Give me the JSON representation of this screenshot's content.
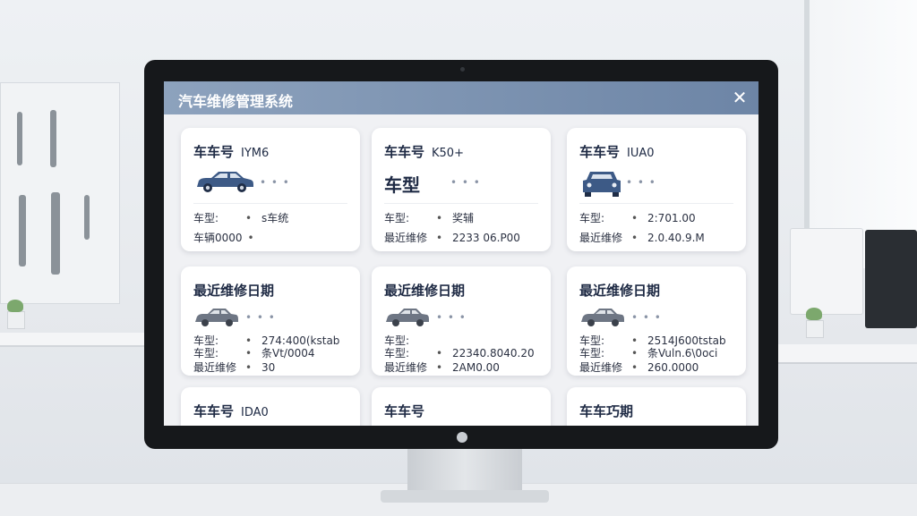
{
  "app": {
    "title": "汽车维修管理系统",
    "close_label": "✕"
  },
  "cards": [
    {
      "title": "车车号",
      "plate": "IYM6",
      "big_label": "",
      "vehicle": "car-side-icon",
      "rows": [
        {
          "label": "车型:",
          "value": "s车统"
        },
        {
          "label": "车辆0000",
          "value": ""
        }
      ]
    },
    {
      "title": "车车号",
      "plate": "K50+",
      "big_label": "车型",
      "vehicle": "",
      "rows": [
        {
          "label": "车型:",
          "value": "奖辅"
        },
        {
          "label": "最近维修",
          "value": "2233 06.P00"
        }
      ]
    },
    {
      "title": "车车号",
      "plate": "IUA0",
      "big_label": "",
      "vehicle": "car-front-icon",
      "rows": [
        {
          "label": "车型:",
          "value": "2:701.00"
        },
        {
          "label": "最近维修",
          "value": "2.0.40.9.M"
        }
      ]
    },
    {
      "title": "最近维修日期",
      "plate": "",
      "big_label": "",
      "vehicle": "car-side-icon",
      "rows": [
        {
          "label": "车型:",
          "value": "274:400(kstab"
        },
        {
          "label": "车型:",
          "value": "条Vt/0004"
        },
        {
          "label": "最近维修",
          "value": "30"
        }
      ]
    },
    {
      "title": "最近维修日期",
      "plate": "",
      "big_label": "",
      "vehicle": "car-side-icon",
      "rows": [
        {
          "label": "车型:",
          "value": ""
        },
        {
          "label": "车型:",
          "value": "22340.8040.20"
        },
        {
          "label": "最近维修",
          "value": "2AM0.00"
        }
      ]
    },
    {
      "title": "最近维修日期",
      "plate": "",
      "big_label": "",
      "vehicle": "car-side-icon",
      "rows": [
        {
          "label": "车型:",
          "value": "2514J600tstab"
        },
        {
          "label": "车型:",
          "value": "条Vuln.6\\0oci"
        },
        {
          "label": "最近维修",
          "value": "260.0000"
        }
      ]
    },
    {
      "title": "车车号",
      "plate": "IDA0",
      "big_label": "",
      "vehicle": "",
      "rows": []
    },
    {
      "title": "车车号",
      "plate": "",
      "big_label": "",
      "vehicle": "",
      "rows": []
    },
    {
      "title": "车车巧期",
      "plate": "",
      "big_label": "",
      "vehicle": "",
      "rows": []
    }
  ],
  "colors": {
    "titlebar": "#7a90b0",
    "car_primary": "#3d5a86",
    "car_muted": "#6e7684"
  }
}
